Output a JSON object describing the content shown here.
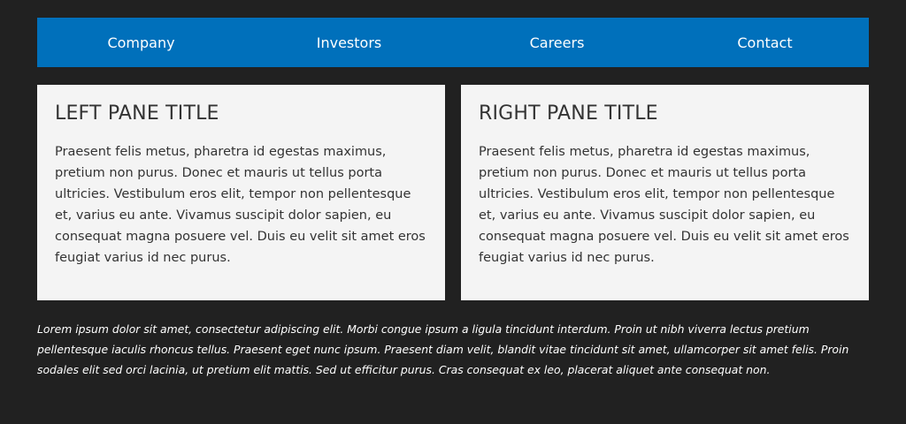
{
  "nav": {
    "items": [
      {
        "label": "Company"
      },
      {
        "label": "Investors"
      },
      {
        "label": "Careers"
      },
      {
        "label": "Contact"
      }
    ]
  },
  "panes": {
    "left": {
      "title": "LEFT PANE TITLE",
      "body": "Praesent felis metus, pharetra id egestas maximus, pretium non purus. Donec et mauris ut tellus porta ultricies. Vestibulum eros elit, tempor non pellentesque et, varius eu ante. Vivamus suscipit dolor sapien, eu consequat magna posuere vel. Duis eu velit sit amet eros feugiat varius id nec purus."
    },
    "right": {
      "title": "RIGHT PANE TITLE",
      "body": "Praesent felis metus, pharetra id egestas maximus, pretium non purus. Donec et mauris ut tellus porta ultricies. Vestibulum eros elit, tempor non pellentesque et, varius eu ante. Vivamus suscipit dolor sapien, eu consequat magna posuere vel. Duis eu velit sit amet eros feugiat varius id nec purus."
    }
  },
  "footer": {
    "text": "Lorem ipsum dolor sit amet, consectetur adipiscing elit. Morbi congue ipsum a ligula tincidunt interdum. Proin ut nibh viverra lectus pretium pellentesque iaculis rhoncus tellus. Praesent eget nunc ipsum. Praesent diam velit, blandit vitae tincidunt sit amet, ullamcorper sit amet felis. Proin sodales elit sed orci lacinia, ut pretium elit mattis. Sed ut efficitur purus. Cras consequat ex leo, placerat aliquet ante consequat non."
  },
  "colors": {
    "background": "#212121",
    "nav_background": "#0070bb",
    "pane_background": "#f4f4f4",
    "pane_text": "#333333",
    "nav_text": "#ffffff"
  }
}
